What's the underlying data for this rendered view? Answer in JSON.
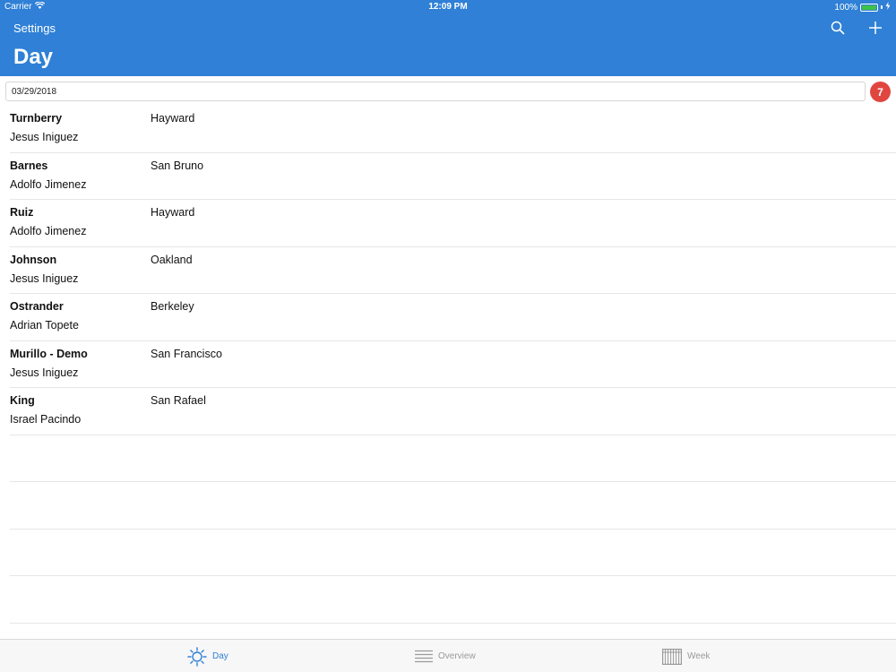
{
  "status": {
    "carrier": "Carrier",
    "time": "12:09 PM",
    "battery": "100%",
    "battery_level": 1.0
  },
  "header": {
    "back_label": "Settings",
    "title": "Day",
    "actions": [
      "search-icon",
      "plus-icon"
    ]
  },
  "date_bar": {
    "date": "03/29/2018",
    "count": "7"
  },
  "rows": [
    {
      "name": "Turnberry",
      "city": "Hayward",
      "person": "Jesus Iniguez"
    },
    {
      "name": "Barnes",
      "city": "San Bruno",
      "person": "Adolfo Jimenez"
    },
    {
      "name": "Ruiz",
      "city": "Hayward",
      "person": "Adolfo Jimenez"
    },
    {
      "name": "Johnson",
      "city": "Oakland",
      "person": "Jesus Iniguez"
    },
    {
      "name": "Ostrander",
      "city": "Berkeley",
      "person": "Adrian Topete"
    },
    {
      "name": "Murillo - Demo",
      "city": "San Francisco",
      "person": "Jesus Iniguez"
    },
    {
      "name": "King",
      "city": "San Rafael",
      "person": "Israel Pacindo"
    }
  ],
  "tabs": [
    {
      "label": "Day",
      "icon": "sun-icon",
      "active": true
    },
    {
      "label": "Overview",
      "icon": "list-lines-icon",
      "active": false
    },
    {
      "label": "Week",
      "icon": "calendar-grid-icon",
      "active": false
    }
  ],
  "colors": {
    "header": "#2f80d6",
    "badge": "#e0463f",
    "active_tab": "#2f80d6",
    "inactive_tab": "#9a9a9a"
  }
}
